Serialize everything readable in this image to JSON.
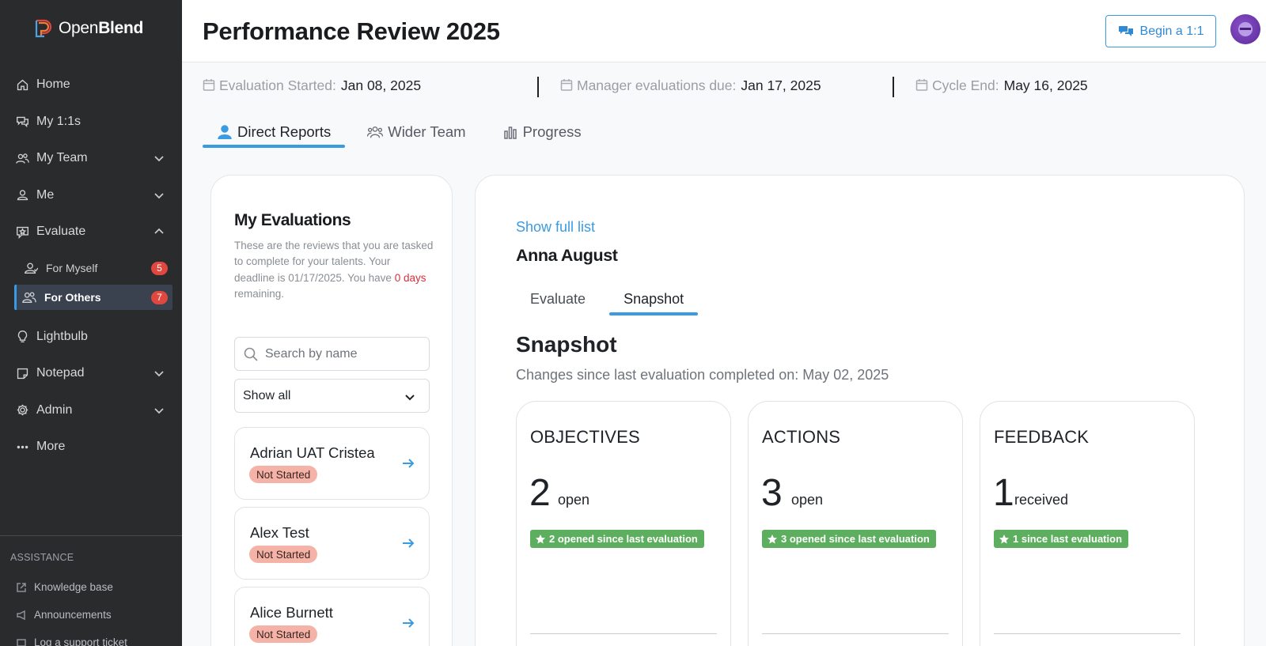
{
  "app": {
    "name_regular": "Open",
    "name_bold": "Blend"
  },
  "sidebar": {
    "items": [
      {
        "label": "Home",
        "icon": "home-icon"
      },
      {
        "label": "My 1:1s",
        "icon": "chat-icon"
      },
      {
        "label": "My Team",
        "icon": "team-icon",
        "expand": "chevron-down"
      },
      {
        "label": "Me",
        "icon": "user-icon",
        "expand": "chevron-down"
      },
      {
        "label": "Evaluate",
        "icon": "evaluate-icon",
        "expand": "chevron-up"
      }
    ],
    "sub_items": [
      {
        "label": "For Myself",
        "badge": "5"
      },
      {
        "label": "For Others",
        "badge": "7"
      }
    ],
    "items_after": [
      {
        "label": "Lightbulb",
        "icon": "lightbulb-icon"
      },
      {
        "label": "Notepad",
        "icon": "notepad-icon",
        "expand": "chevron-down"
      },
      {
        "label": "Admin",
        "icon": "gear-icon",
        "expand": "chevron-down"
      },
      {
        "label": "More",
        "icon": "more-icon"
      }
    ],
    "assistance": {
      "title": "ASSISTANCE",
      "items": [
        "Knowledge base",
        "Announcements",
        "Log a support ticket"
      ]
    }
  },
  "header": {
    "title": "Performance Review 2025",
    "begin_button": "Begin a 1:1"
  },
  "dates": [
    {
      "label": "Evaluation Started:",
      "value": "Jan 08, 2025"
    },
    {
      "label": "Manager evaluations due:",
      "value": "Jan 17, 2025"
    },
    {
      "label": "Cycle End:",
      "value": "May 16, 2025"
    }
  ],
  "tabs": [
    "Direct Reports",
    "Wider Team",
    "Progress"
  ],
  "evaluations": {
    "title": "My Evaluations",
    "desc_prefix": "These are the reviews that you are tasked to complete for your talents. Your deadline is 01/17/2025. You have",
    "desc_highlight": "0 days",
    "desc_suffix": "remaining.",
    "search_placeholder": "Search by name",
    "filter_value": "Show all",
    "people": [
      {
        "name": "Adrian UAT Cristea",
        "status": "Not Started"
      },
      {
        "name": "Alex Test",
        "status": "Not Started"
      },
      {
        "name": "Alice Burnett",
        "status": "Not Started"
      }
    ]
  },
  "detail": {
    "show_full": "Show full list",
    "name": "Anna August",
    "subtabs": [
      "Evaluate",
      "Snapshot"
    ],
    "snapshot_title": "Snapshot",
    "snapshot_subtitle": "Changes since last evaluation completed on: May 02, 2025",
    "metrics": [
      {
        "title": "OBJECTIVES",
        "number": "2",
        "unit": "open",
        "pill": "2 opened since last evaluation"
      },
      {
        "title": "ACTIONS",
        "number": "3",
        "unit": "open",
        "pill": "3 opened since last evaluation"
      },
      {
        "title": "FEEDBACK",
        "number": "1",
        "unit": "received",
        "pill": "1 since last evaluation"
      }
    ]
  },
  "colors": {
    "accent": "#3b9be2",
    "sidebar": "#2a2b2d",
    "badge": "#e0473f",
    "status": "#f5b2a6",
    "pill": "#5daf5f",
    "deadline": "#d92d3b"
  }
}
